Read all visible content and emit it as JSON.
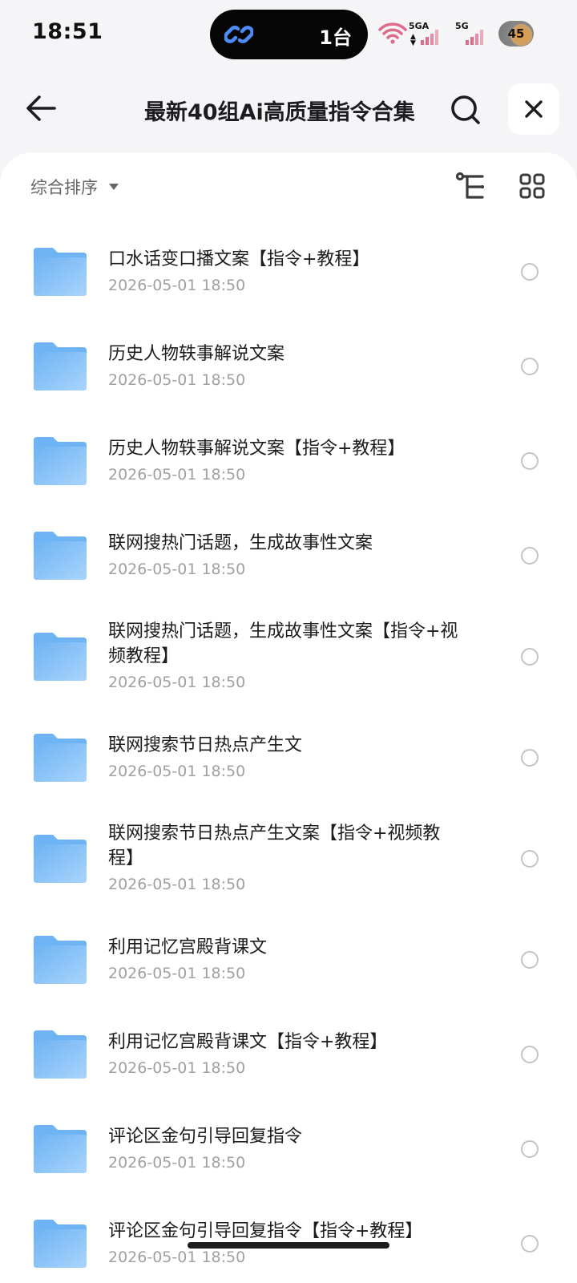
{
  "status_bar": {
    "time": "18:51",
    "island_text": "1台",
    "net1": "5GA",
    "net2": "5G",
    "battery": "45"
  },
  "nav": {
    "title": "最新40组Ai高质量指令合集"
  },
  "sort": {
    "label": "综合排序"
  },
  "files": [
    {
      "name": "口水话变口播文案【指令+教程】",
      "date": "2026-05-01 18:50"
    },
    {
      "name": "历史人物轶事解说文案",
      "date": "2026-05-01 18:50"
    },
    {
      "name": "历史人物轶事解说文案【指令+教程】",
      "date": "2026-05-01 18:50"
    },
    {
      "name": "联网搜热门话题，生成故事性文案",
      "date": "2026-05-01 18:50"
    },
    {
      "name": "联网搜热门话题，生成故事性文案【指令+视频教程】",
      "date": "2026-05-01 18:50"
    },
    {
      "name": "联网搜索节日热点产生文",
      "date": "2026-05-01 18:50"
    },
    {
      "name": "联网搜索节日热点产生文案【指令+视频教程】",
      "date": "2026-05-01 18:50"
    },
    {
      "name": "利用记忆宫殿背课文",
      "date": "2026-05-01 18:50"
    },
    {
      "name": "利用记忆宫殿背课文【指令+教程】",
      "date": "2026-05-01 18:50"
    },
    {
      "name": "评论区金句引导回复指令",
      "date": "2026-05-01 18:50"
    },
    {
      "name": "评论区金句引导回复指令【指令+教程】",
      "date": "2026-05-01 18:50"
    }
  ],
  "colors": {
    "folder_light": "#a9d4fb",
    "folder_dark": "#6eb3f3",
    "accent_link": "#4b8cf5"
  }
}
